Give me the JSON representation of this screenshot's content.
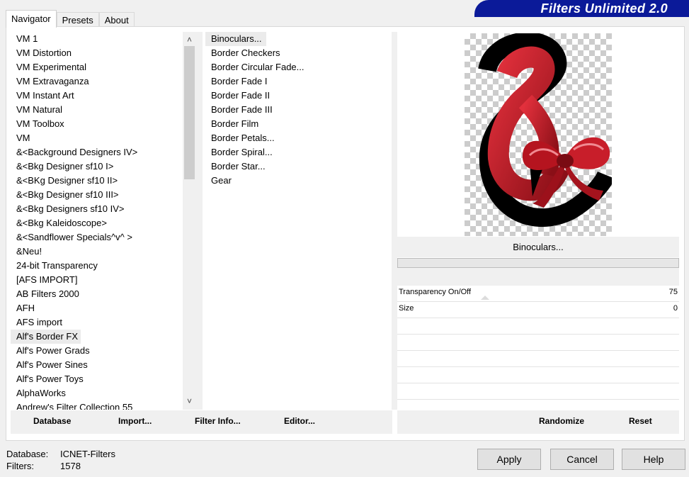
{
  "tabs": [
    "Navigator",
    "Presets",
    "About"
  ],
  "brand": "Filters Unlimited 2.0",
  "categories": [
    "VM 1",
    "VM Distortion",
    "VM Experimental",
    "VM Extravaganza",
    "VM Instant Art",
    "VM Natural",
    "VM Toolbox",
    "VM",
    "&<Background Designers IV>",
    "&<Bkg Designer sf10 I>",
    "&<BKg Designer sf10 II>",
    "&<Bkg Designer sf10 III>",
    "&<Bkg Designers sf10 IV>",
    "&<Bkg Kaleidoscope>",
    "&<Sandflower Specials^v^ >",
    "&Neu!",
    "24-bit Transparency",
    "[AFS IMPORT]",
    "AB Filters 2000",
    "AFH",
    "AFS import",
    "Alf's Border FX",
    "Alf's Power Grads",
    "Alf's Power Sines",
    "Alf's Power Toys",
    "AlphaWorks",
    "Andrew's Filter Collection 55"
  ],
  "selected_category": "Alf's Border FX",
  "filters": [
    "Binoculars...",
    "Border Checkers",
    "Border Circular Fade...",
    "Border Fade I",
    "Border Fade II",
    "Border Fade III",
    "Border Film",
    "Border Petals...",
    "Border Spiral...",
    "Border Star...",
    "Gear"
  ],
  "selected_filter": "Binoculars...",
  "filter_name": "Binoculars...",
  "params": [
    {
      "label": "Transparency On/Off",
      "value": "75"
    },
    {
      "label": "Size",
      "value": "0"
    }
  ],
  "left_buttons": {
    "database": "Database",
    "import": "Import...",
    "filter_info": "Filter Info...",
    "editor": "Editor..."
  },
  "right_buttons": {
    "randomize": "Randomize",
    "reset": "Reset"
  },
  "status": {
    "database_label": "Database:",
    "database_value": "ICNET-Filters",
    "filters_label": "Filters:",
    "filters_value": "1578"
  },
  "dialog": {
    "apply": "Apply",
    "cancel": "Cancel",
    "help": "Help"
  },
  "icons": {
    "up": "chevron-up-icon",
    "down": "chevron-down-icon"
  }
}
